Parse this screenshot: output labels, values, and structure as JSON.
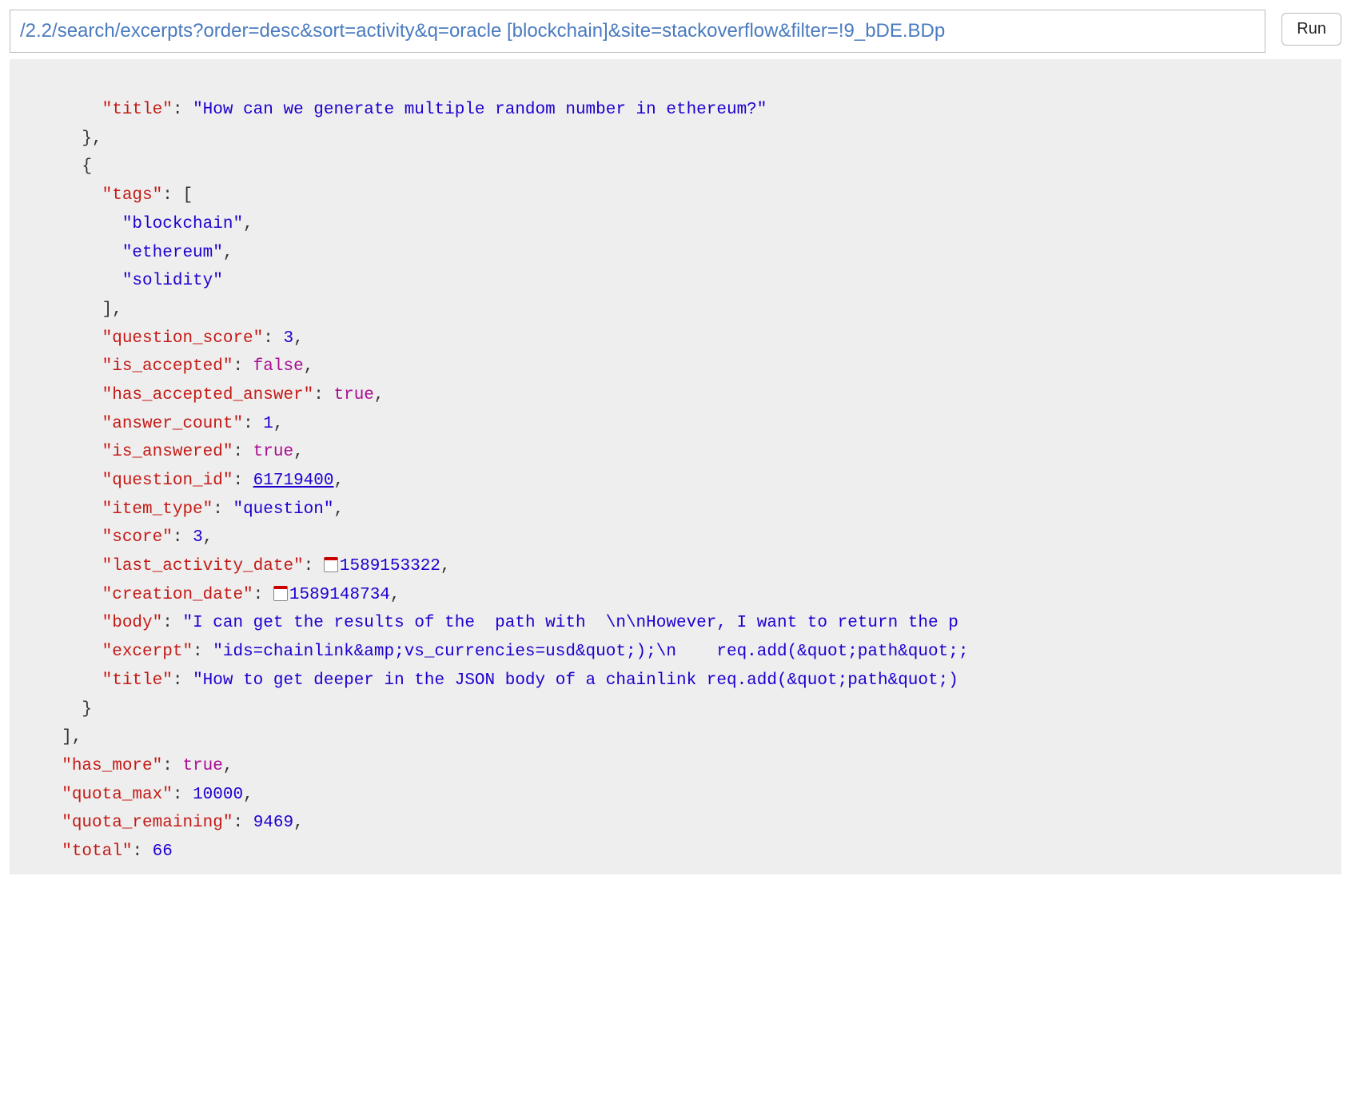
{
  "header": {
    "url": "/2.2/search/excerpts?order=desc&sort=activity&q=oracle [blockchain]&site=stackoverflow&filter=!9_bDE.BDp",
    "run_label": "Run"
  },
  "json_response": {
    "leading_item": {
      "title_key": "\"title\"",
      "title_val": "\"How can we generate multiple random number in ethereum?\""
    },
    "item2": {
      "tags_key": "\"tags\"",
      "tags": [
        "\"blockchain\"",
        "\"ethereum\"",
        "\"solidity\""
      ],
      "question_score_key": "\"question_score\"",
      "question_score_val": "3",
      "is_accepted_key": "\"is_accepted\"",
      "is_accepted_val": "false",
      "has_accepted_answer_key": "\"has_accepted_answer\"",
      "has_accepted_answer_val": "true",
      "answer_count_key": "\"answer_count\"",
      "answer_count_val": "1",
      "is_answered_key": "\"is_answered\"",
      "is_answered_val": "true",
      "question_id_key": "\"question_id\"",
      "question_id_val": "61719400",
      "item_type_key": "\"item_type\"",
      "item_type_val": "\"question\"",
      "score_key": "\"score\"",
      "score_val": "3",
      "last_activity_date_key": "\"last_activity_date\"",
      "last_activity_date_val": "1589153322",
      "creation_date_key": "\"creation_date\"",
      "creation_date_val": "1589148734",
      "body_key": "\"body\"",
      "body_val": "\"I can get the results of the  path with  \\n\\nHowever, I want to return the p",
      "excerpt_key": "\"excerpt\"",
      "excerpt_val": "\"ids=chainlink&amp;vs_currencies=usd&quot;);\\n    req.add(&quot;path&quot;;",
      "title_key": "\"title\"",
      "title_val": "\"How to get deeper in the JSON body of a chainlink req.add(&quot;path&quot;)"
    },
    "footer": {
      "has_more_key": "\"has_more\"",
      "has_more_val": "true",
      "quota_max_key": "\"quota_max\"",
      "quota_max_val": "10000",
      "quota_remaining_key": "\"quota_remaining\"",
      "quota_remaining_val": "9469",
      "total_key": "\"total\"",
      "total_val": "66"
    }
  }
}
